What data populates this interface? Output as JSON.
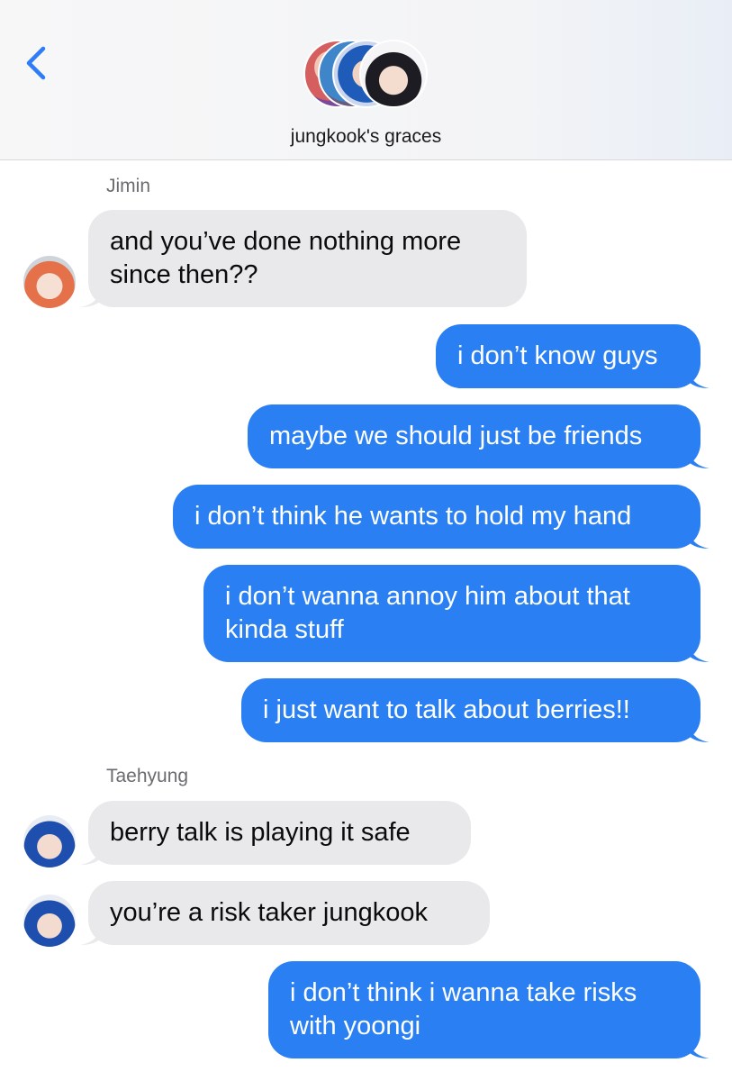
{
  "header": {
    "back_icon": "chevron-left-icon",
    "group_name": "jungkook's graces",
    "accent": "#2f7df6"
  },
  "colors": {
    "incoming_bubble": "#e9e9eb",
    "outgoing_bubble": "#2a7ff3"
  },
  "messages": [
    {
      "type": "sender",
      "text": "Jimin"
    },
    {
      "type": "incoming",
      "text": "and you’ve done nothing more\nsince then??"
    },
    {
      "type": "outgoing",
      "text": "i don’t know guys"
    },
    {
      "type": "outgoing",
      "text": "maybe we should just be friends"
    },
    {
      "type": "outgoing",
      "text": "i don’t think he wants to hold my hand"
    },
    {
      "type": "outgoing",
      "text": "i don’t wanna annoy him about that\nkinda stuff"
    },
    {
      "type": "outgoing",
      "text": "i just want to talk about berries!!"
    },
    {
      "type": "sender",
      "text": "Taehyung"
    },
    {
      "type": "incoming",
      "text": "berry talk is playing it safe"
    },
    {
      "type": "incoming",
      "text": "you’re a risk taker jungkook"
    },
    {
      "type": "outgoing",
      "text": "i don’t think i wanna take risks\nwith yoongi"
    }
  ]
}
